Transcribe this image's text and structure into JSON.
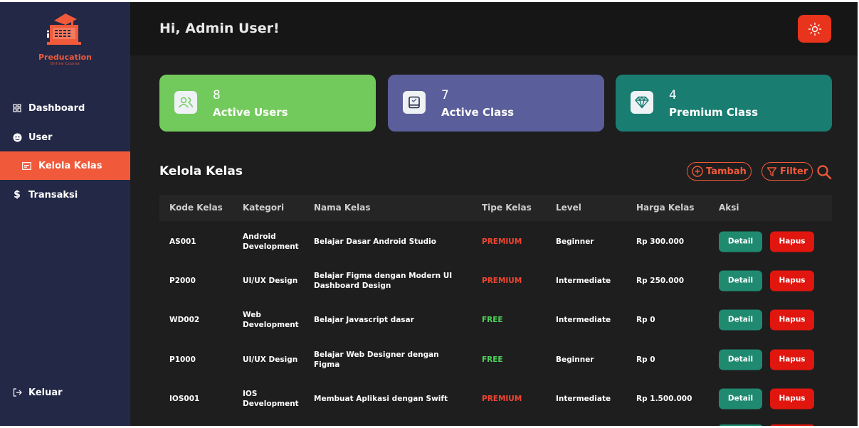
{
  "brand": {
    "name": "Preducation",
    "tagline": "Online Course"
  },
  "sidebar": {
    "items": [
      {
        "label": "Dashboard",
        "icon": "grid-icon"
      },
      {
        "label": "User",
        "icon": "user-circle-icon"
      },
      {
        "label": "Kelola Kelas",
        "icon": "class-board-icon",
        "active": true
      },
      {
        "label": "Transaksi",
        "icon": "dollar-icon"
      }
    ],
    "logout": "Keluar"
  },
  "header": {
    "greeting": "Hi, Admin User!",
    "theme_icon": "sun-icon"
  },
  "stats": [
    {
      "value": "8",
      "label": "Active Users",
      "color": "#73ca5c",
      "icon": "users-icon"
    },
    {
      "value": "7",
      "label": "Active Class",
      "color": "#5a5e9a",
      "icon": "class-icon"
    },
    {
      "value": "4",
      "label": "Premium Class",
      "color": "#197d71",
      "icon": "diamond-icon"
    }
  ],
  "section": {
    "title": "Kelola Kelas",
    "add_label": "Tambah",
    "filter_label": "Filter"
  },
  "table": {
    "headers": [
      "Kode Kelas",
      "Kategori",
      "Nama Kelas",
      "Tipe Kelas",
      "Level",
      "Harga Kelas",
      "Aksi"
    ],
    "rows": [
      {
        "kode": "AS001",
        "kategori": "Android Development",
        "nama": "Belajar Dasar Android Studio",
        "tipe": "PREMIUM",
        "level": "Beginner",
        "harga": "Rp 300.000"
      },
      {
        "kode": "P2000",
        "kategori": "UI/UX Design",
        "nama": "Belajar Figma dengan Modern UI Dashboard Design",
        "tipe": "PREMIUM",
        "level": "Intermediate",
        "harga": "Rp 250.000"
      },
      {
        "kode": "WD002",
        "kategori": "Web Development",
        "nama": "Belajar Javascript dasar",
        "tipe": "FREE",
        "level": "Intermediate",
        "harga": "Rp 0"
      },
      {
        "kode": "P1000",
        "kategori": "UI/UX Design",
        "nama": "Belajar Web Designer dengan Figma",
        "tipe": "FREE",
        "level": "Beginner",
        "harga": "Rp 0"
      },
      {
        "kode": "IOS001",
        "kategori": "IOS Development",
        "nama": "Membuat Aplikasi dengan Swift",
        "tipe": "PREMIUM",
        "level": "Intermediate",
        "harga": "Rp 1.500.000"
      }
    ],
    "detail_label": "Detail",
    "hapus_label": "Hapus"
  },
  "colors": {
    "accent": "#f05a3a",
    "sidebar": "#232846",
    "detail": "#1f8a70",
    "hapus": "#e0160f",
    "premium": "#f04432",
    "free": "#4fd05a"
  }
}
